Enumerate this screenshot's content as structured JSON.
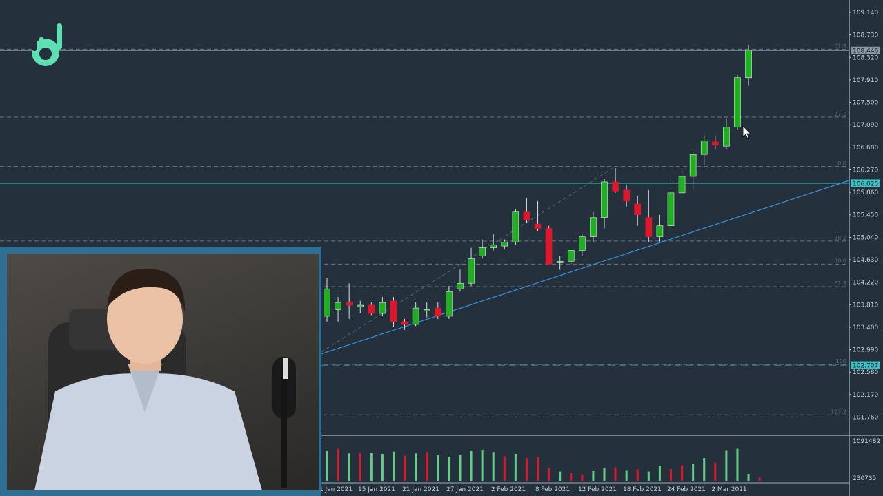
{
  "chart_data": {
    "type": "candlestick",
    "price_ticks": [
      "109.140",
      "108.730",
      "108.320",
      "107.910",
      "107.500",
      "107.090",
      "106.680",
      "106.270",
      "105.860",
      "105.450",
      "105.040",
      "104.630",
      "104.220",
      "103.810",
      "103.400",
      "102.990",
      "102.580",
      "102.170",
      "101.760"
    ],
    "date_ticks": [
      "1 Jan 2021",
      "15 Jan 2021",
      "21 Jan 2021",
      "27 Jan 2021",
      "2 Feb 2021",
      "8 Feb 2021",
      "12 Feb 2021",
      "18 Feb 2021",
      "24 Feb 2021",
      "2 Mar 2021"
    ],
    "price_tags": [
      {
        "value": 108.446,
        "label": "108.446",
        "color": "#8a96a0"
      },
      {
        "value": 106.025,
        "label": "106.025",
        "color": "#3fbfc1"
      },
      {
        "value": 102.707,
        "label": "102.707",
        "color": "#3fbfc1"
      }
    ],
    "fib_levels": [
      {
        "value": 108.47,
        "label": "61.8"
      },
      {
        "value": 107.23,
        "label": "-27.2"
      },
      {
        "value": 106.33,
        "label": "0.0"
      },
      {
        "value": 104.97,
        "label": "38.2"
      },
      {
        "value": 104.55,
        "label": "50.0"
      },
      {
        "value": 104.14,
        "label": "61.8"
      },
      {
        "value": 102.72,
        "label": "100"
      },
      {
        "value": 101.8,
        "label": "127.2"
      }
    ],
    "ylim": [
      101.5,
      109.35
    ],
    "volume_ticks": [
      "1091482",
      "230735"
    ],
    "volume_range": [
      230735,
      1091482
    ],
    "trendline": [
      {
        "bar": -1,
        "price": 102.88
      },
      {
        "bar": 47,
        "price": 106.07
      }
    ],
    "candles": [
      {
        "o": 103.6,
        "h": 104.3,
        "l": 103.5,
        "c": 104.1
      },
      {
        "o": 103.72,
        "h": 103.95,
        "l": 103.5,
        "c": 103.85
      },
      {
        "o": 103.85,
        "h": 104.2,
        "l": 103.55,
        "c": 103.8
      },
      {
        "o": 103.78,
        "h": 103.88,
        "l": 103.65,
        "c": 103.8
      },
      {
        "o": 103.8,
        "h": 103.85,
        "l": 103.62,
        "c": 103.65
      },
      {
        "o": 103.65,
        "h": 103.95,
        "l": 103.6,
        "c": 103.85
      },
      {
        "o": 103.88,
        "h": 103.95,
        "l": 103.4,
        "c": 103.5
      },
      {
        "o": 103.5,
        "h": 103.55,
        "l": 103.35,
        "c": 103.45
      },
      {
        "o": 103.45,
        "h": 103.85,
        "l": 103.42,
        "c": 103.75
      },
      {
        "o": 103.7,
        "h": 103.85,
        "l": 103.58,
        "c": 103.72
      },
      {
        "o": 103.75,
        "h": 103.85,
        "l": 103.55,
        "c": 103.6
      },
      {
        "o": 103.6,
        "h": 104.15,
        "l": 103.55,
        "c": 104.05
      },
      {
        "o": 104.1,
        "h": 104.45,
        "l": 104.05,
        "c": 104.2
      },
      {
        "o": 104.2,
        "h": 104.85,
        "l": 104.15,
        "c": 104.65
      },
      {
        "o": 104.7,
        "h": 105.0,
        "l": 104.65,
        "c": 104.85
      },
      {
        "o": 104.85,
        "h": 105.1,
        "l": 104.8,
        "c": 104.9
      },
      {
        "o": 104.88,
        "h": 105.0,
        "l": 104.82,
        "c": 104.95
      },
      {
        "o": 104.95,
        "h": 105.55,
        "l": 104.9,
        "c": 105.5
      },
      {
        "o": 105.5,
        "h": 105.75,
        "l": 105.3,
        "c": 105.35
      },
      {
        "o": 105.28,
        "h": 105.7,
        "l": 105.15,
        "c": 105.2
      },
      {
        "o": 105.2,
        "h": 105.25,
        "l": 104.55,
        "c": 104.55
      },
      {
        "o": 104.58,
        "h": 104.7,
        "l": 104.45,
        "c": 104.6
      },
      {
        "o": 104.6,
        "h": 104.8,
        "l": 104.55,
        "c": 104.8
      },
      {
        "o": 104.8,
        "h": 105.1,
        "l": 104.7,
        "c": 105.05
      },
      {
        "o": 105.05,
        "h": 105.5,
        "l": 104.95,
        "c": 105.4
      },
      {
        "o": 105.4,
        "h": 106.1,
        "l": 105.2,
        "c": 106.05
      },
      {
        "o": 106.05,
        "h": 106.3,
        "l": 105.85,
        "c": 105.88
      },
      {
        "o": 105.9,
        "h": 106.0,
        "l": 105.6,
        "c": 105.7
      },
      {
        "o": 105.65,
        "h": 105.8,
        "l": 105.25,
        "c": 105.45
      },
      {
        "o": 105.4,
        "h": 105.9,
        "l": 104.95,
        "c": 105.05
      },
      {
        "o": 105.05,
        "h": 105.45,
        "l": 104.95,
        "c": 105.25
      },
      {
        "o": 105.25,
        "h": 106.1,
        "l": 105.2,
        "c": 105.85
      },
      {
        "o": 105.85,
        "h": 106.3,
        "l": 105.8,
        "c": 106.15
      },
      {
        "o": 106.15,
        "h": 106.6,
        "l": 105.9,
        "c": 106.55
      },
      {
        "o": 106.55,
        "h": 106.9,
        "l": 106.35,
        "c": 106.8
      },
      {
        "o": 106.78,
        "h": 106.9,
        "l": 106.65,
        "c": 106.72
      },
      {
        "o": 106.7,
        "h": 107.2,
        "l": 106.65,
        "c": 107.05
      },
      {
        "o": 107.05,
        "h": 108.0,
        "l": 107.0,
        "c": 107.95
      },
      {
        "o": 107.95,
        "h": 108.55,
        "l": 107.8,
        "c": 108.45
      }
    ],
    "volume_colors": [
      "g",
      "r",
      "g",
      "r",
      "g",
      "g",
      "g",
      "r",
      "g",
      "r",
      "g",
      "g",
      "g",
      "g",
      "g",
      "g",
      "r",
      "g",
      "r",
      "r",
      "r",
      "g",
      "r",
      "r",
      "g",
      "g",
      "r",
      "g",
      "r",
      "g",
      "g",
      "r",
      "r",
      "g",
      "g",
      "r",
      "g",
      "g",
      "g",
      "r"
    ],
    "volume_values": [
      880000,
      920000,
      820000,
      840000,
      830000,
      810000,
      860000,
      770000,
      820000,
      850000,
      780000,
      750000,
      790000,
      880000,
      900000,
      850000,
      760000,
      810000,
      720000,
      740000,
      500000,
      430000,
      400000,
      370000,
      450000,
      500000,
      520000,
      460000,
      480000,
      430000,
      550000,
      480000,
      560000,
      600000,
      720000,
      620000,
      890000,
      920000,
      380000,
      300000
    ]
  }
}
